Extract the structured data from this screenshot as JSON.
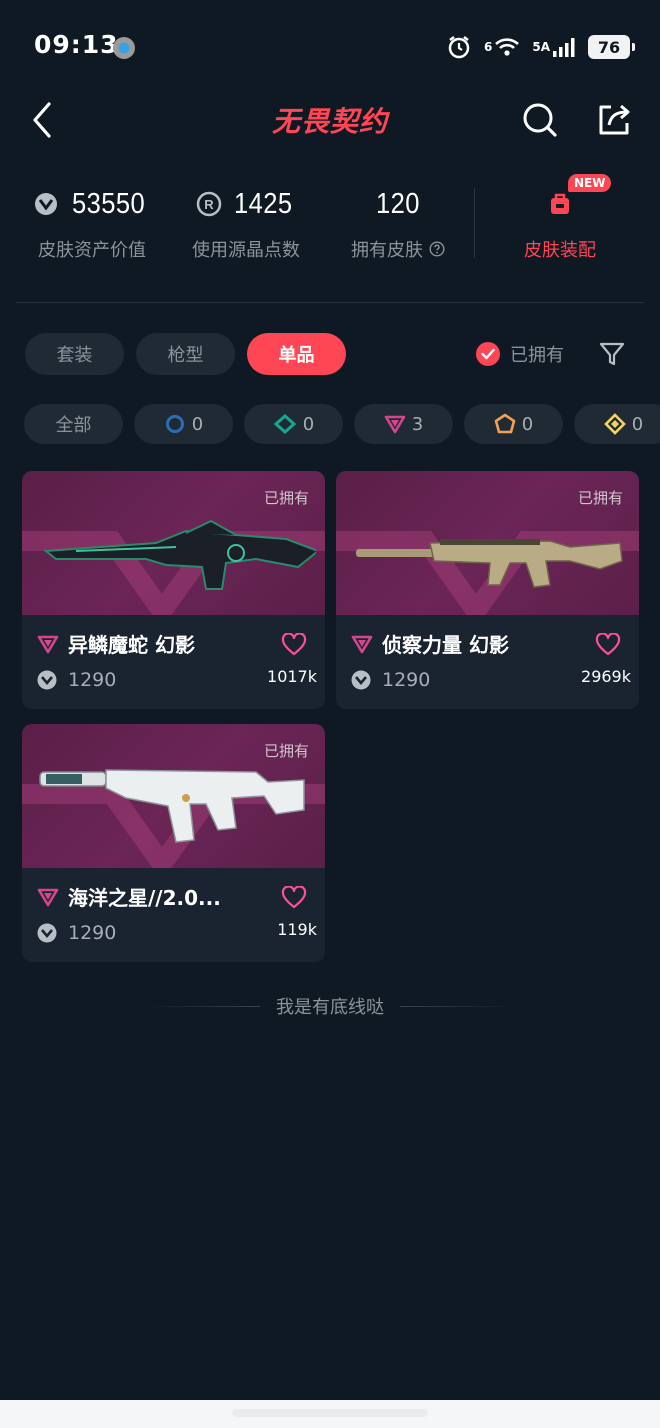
{
  "status_bar": {
    "time": "09:13",
    "network": "5A",
    "wifi_sup": "6",
    "battery": "76"
  },
  "header": {
    "title": "无畏契约"
  },
  "stats": {
    "asset_value": "53550",
    "asset_value_label": "皮肤资产价值",
    "points_used": "1425",
    "points_used_label": "使用源晶点数",
    "skins_owned": "120",
    "skins_owned_label": "拥有皮肤",
    "loadout_badge": "NEW",
    "loadout_label": "皮肤装配"
  },
  "tabs": [
    {
      "label": "套装",
      "active": false
    },
    {
      "label": "枪型",
      "active": false
    },
    {
      "label": "单品",
      "active": true
    }
  ],
  "filter": {
    "owned_label": "已拥有"
  },
  "tiers": [
    {
      "label": "全部",
      "count": ""
    },
    {
      "icon": "select-tier-icon",
      "color": "#2a6fb5",
      "count": "0"
    },
    {
      "icon": "deluxe-tier-icon",
      "color": "#1aa58e",
      "count": "0"
    },
    {
      "icon": "premium-tier-icon",
      "color": "#d4478e",
      "count": "3"
    },
    {
      "icon": "exclusive-tier-icon",
      "color": "#f2a157",
      "count": "0"
    },
    {
      "icon": "ultra-tier-icon",
      "color": "#f5d55e",
      "count": "0"
    }
  ],
  "skins": [
    {
      "name": "异鳞魔蛇 幻影",
      "owned": "已拥有",
      "price": "1290",
      "likes": "1017k",
      "tier_color": "#d4478e"
    },
    {
      "name": "侦察力量 幻影",
      "owned": "已拥有",
      "price": "1290",
      "likes": "2969k",
      "tier_color": "#d4478e"
    },
    {
      "name": "海洋之星//2.0...",
      "owned": "已拥有",
      "price": "1290",
      "likes": "119k",
      "tier_color": "#d4478e"
    }
  ],
  "footer": {
    "text": "我是有底线哒"
  }
}
